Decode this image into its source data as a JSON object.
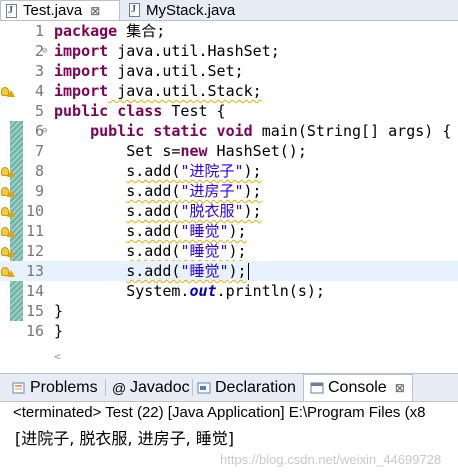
{
  "editor_tabs": [
    {
      "label": "Test.java",
      "active": true,
      "close": "⊠"
    },
    {
      "label": "MyStack.java",
      "active": false
    }
  ],
  "code_lines": [
    {
      "n": "1",
      "fold": "",
      "warn": false,
      "change": false
    },
    {
      "n": "2",
      "fold": "⊖",
      "warn": false,
      "change": false
    },
    {
      "n": "3",
      "fold": "",
      "warn": false,
      "change": false
    },
    {
      "n": "4",
      "fold": "",
      "warn": true,
      "change": false
    },
    {
      "n": "5",
      "fold": "",
      "warn": false,
      "change": false
    },
    {
      "n": "6",
      "fold": "⊖",
      "warn": false,
      "change": true
    },
    {
      "n": "7",
      "fold": "",
      "warn": false,
      "change": true
    },
    {
      "n": "8",
      "fold": "",
      "warn": true,
      "change": true
    },
    {
      "n": "9",
      "fold": "",
      "warn": true,
      "change": true
    },
    {
      "n": "10",
      "fold": "",
      "warn": true,
      "change": true
    },
    {
      "n": "11",
      "fold": "",
      "warn": true,
      "change": true
    },
    {
      "n": "12",
      "fold": "",
      "warn": true,
      "change": true
    },
    {
      "n": "13",
      "fold": "",
      "warn": true,
      "change": true
    },
    {
      "n": "14",
      "fold": "",
      "warn": false,
      "change": true
    },
    {
      "n": "15",
      "fold": "",
      "warn": false,
      "change": true
    },
    {
      "n": "16",
      "fold": "",
      "warn": false,
      "change": false
    }
  ],
  "code": {
    "l1_kw": "package",
    "l1_rest": " 集合;",
    "l2_kw": "import",
    "l2_rest": " java.util.HashSet;",
    "l3_kw": "import",
    "l3_rest": " java.util.Set;",
    "l4_kw": "import",
    "l4_rest": " java.util.Stack;",
    "l5_kw": "public class",
    "l5_rest": " Test {",
    "l6_kw": "public static void",
    "l6_rest": " main(String[] args) {",
    "l7_a": "Set s=",
    "l7_kw": "new",
    "l7_b": " HashSet();",
    "l8_a": "s.add(",
    "l8_str": "\"进院子\"",
    "l8_b": ");",
    "l9_a": "s.add(",
    "l9_str": "\"进房子\"",
    "l9_b": ");",
    "l10_a": "s.add(",
    "l10_str": "\"脱衣服\"",
    "l10_b": ");",
    "l11_a": "s.add(",
    "l11_str": "\"睡觉\"",
    "l11_b": ");",
    "l12_a": "s.add(",
    "l12_str": "\"睡觉\"",
    "l12_b": ");",
    "l13_a": "s.add(",
    "l13_str": "\"睡觉\"",
    "l13_b": ");",
    "l14_a": "System.",
    "l14_fld": "out",
    "l14_b": ".println(s);",
    "l15": "}",
    "l16": "}",
    "scroll_arrow": "<"
  },
  "panel_tabs": [
    {
      "label": "Problems",
      "icon": "problems-icon"
    },
    {
      "label": "Javadoc",
      "icon": "at-icon"
    },
    {
      "label": "Declaration",
      "icon": "declaration-icon"
    },
    {
      "label": "Console",
      "icon": "console-icon",
      "active": true,
      "close": "⊠"
    }
  ],
  "console": {
    "title": "<terminated> Test (22) [Java Application] E:\\Program Files (x8",
    "output": "[进院子, 脱衣服, 进房子, 睡觉]"
  },
  "watermark": "https://blog.csdn.net/weixin_44699728",
  "colors": {
    "keyword": "#7f0055",
    "string": "#2a00ff",
    "field": "#0000c0",
    "current_line": "#e8f2fe"
  }
}
